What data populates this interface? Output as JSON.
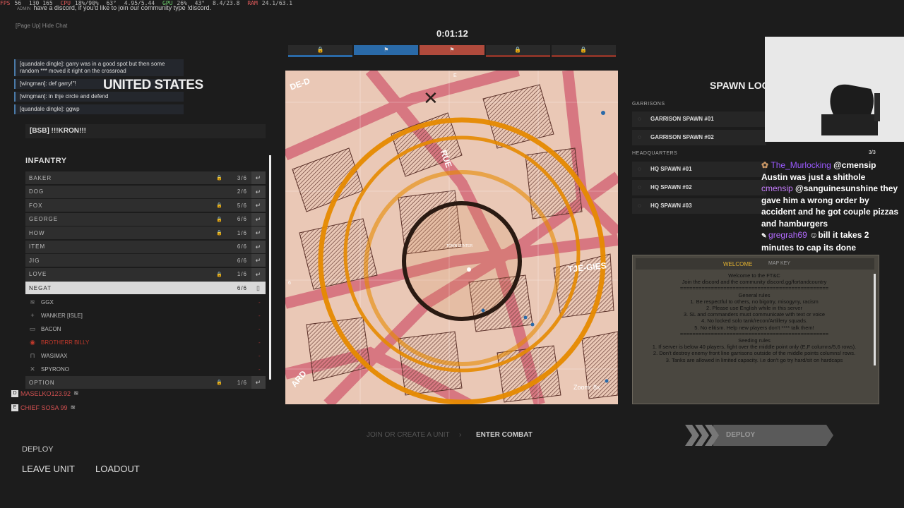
{
  "perf": {
    "fps_label": "FPS",
    "fps": "56",
    "lows": "130 165",
    "cpu_label": "CPU",
    "cpu": "18%/90%",
    "gpu_temp": "63°",
    "clock": "4.95/5.44",
    "gpu_label": "GPU",
    "gpu": "26%",
    "gpu_temp2": "43°",
    "vram": "8.4/23.8",
    "ram_label": "RAM",
    "ram": "24.1/63.1"
  },
  "chat": {
    "top_line": "have a discord, if you'd like to join our community type !discord.",
    "admin_tag": "ADMIN",
    "hide_chat": "[Page Up]  Hide Chat",
    "messages": [
      "[quandale dingle]: garry was in a good spot but then some random *** moved it right on the crossroad",
      "[wingman]: def garry!\"!",
      "[wingman]: in thje circle and defend",
      "[quandale dingle]: ggwp"
    ]
  },
  "team_name": "UNITED STATES",
  "squad_title": "[BSB] !!!KRON!!!",
  "unit_header": "INFANTRY",
  "units": [
    {
      "name": "BAKER",
      "count": "3/6",
      "locked": true
    },
    {
      "name": "DOG",
      "count": "2/6",
      "locked": false
    },
    {
      "name": "FOX",
      "count": "5/6",
      "locked": true
    },
    {
      "name": "GEORGE",
      "count": "6/6",
      "locked": true
    },
    {
      "name": "HOW",
      "count": "1/6",
      "locked": true
    },
    {
      "name": "ITEM",
      "count": "6/6",
      "locked": false
    },
    {
      "name": "JIG",
      "count": "6/6",
      "locked": false
    },
    {
      "name": "LOVE",
      "count": "1/6",
      "locked": true
    },
    {
      "name": "NEGAT",
      "count": "6/6",
      "locked": false
    }
  ],
  "members": [
    {
      "name": "GGX",
      "icon": "≋",
      "red": false
    },
    {
      "name": "WANKER [ISLE]",
      "icon": "+",
      "red": false
    },
    {
      "name": "BACON",
      "icon": "▭",
      "red": false
    },
    {
      "name": "BROTHERR BILLY",
      "icon": "◉",
      "red": true
    },
    {
      "name": "WASIMAX",
      "icon": "⊓",
      "red": false
    },
    {
      "name": "SPYRONO",
      "icon": "✕",
      "red": false
    }
  ],
  "option_row": {
    "name": "OPTION",
    "count": "1/6"
  },
  "extras": [
    {
      "badge": "D",
      "name": "MASELKO123.92"
    },
    {
      "badge": "E",
      "name": "CHIEF SOSA 99"
    }
  ],
  "deploy_label": "DEPLOY",
  "leave_unit": "LEAVE UNIT",
  "loadout": "LOADOUT",
  "timer": "0:01:12",
  "map": {
    "label": "TOWN CENTER",
    "zoom": "Zoom: 8x",
    "grid_letter": "E",
    "grid_num": "6",
    "street1": "RUE",
    "street2": "TJE-GIES",
    "street3": "DE-D",
    "street4": "ARD"
  },
  "spawn_title": "SPAWN LOC",
  "garrisons_label": "GARRISONS",
  "garrisons": [
    "GARRISON SPAWN #01",
    "GARRISON SPAWN #02"
  ],
  "hq_label": "HEADQUARTERS",
  "hq": [
    "HQ SPAWN #01",
    "HQ SPAWN #02",
    "HQ SPAWN #03"
  ],
  "welcome": {
    "tab1": "WELCOME",
    "tab2": "MAP KEY",
    "lines": [
      "Welcome to the FT&C",
      "Join the discord and the community discord.gg/fortandcountry",
      "================================================",
      "General rules",
      "1. Be respectful to others, no bigotry, misogyny, racism",
      "2. Please use English while in this server",
      "3. SL and commanders must communicate with text or voice",
      "4. No locked solo tank/recon/Artillery squads.",
      "5. No elitism. Help new players don't **** talk them!",
      "================================================",
      "Seeding rules",
      "1. If server is below 40 players, fight over the middle point only (E,F columns/5,6 rows).",
      "2. Don't destroy enemy front line garrisons outside of the middle points columns/ rows.",
      "3. Tanks are allowed in limited capacity. I.e don't go try hard/sit on hardcaps"
    ]
  },
  "join_unit": "JOIN OR CREATE A UNIT",
  "enter_combat": "ENTER COMBAT",
  "deploy_btn": "DEPLOY",
  "twitch": {
    "counter": "3/3",
    "msg1_user": "The_Murlocking",
    "msg1_text": "@cmensip Austin was just a shithole",
    "msg2_user": "cmensip",
    "msg2_text": "@sanguinesunshine they gave him a wrong order by accident and he got couple pizzas and hamburgers",
    "msg3_user": "gregrah69",
    "msg3_text": "bill it takes 2 minutes to cap its done",
    "colors": {
      "murlocking": "#9b59ff",
      "cmensip": "#c77dff",
      "gregrah": "#b36bff"
    }
  }
}
